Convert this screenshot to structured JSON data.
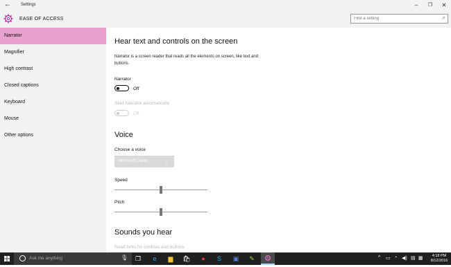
{
  "titlebar": {
    "back_glyph": "←",
    "app_title": "Settings",
    "min_glyph": "–",
    "max_glyph": "❐",
    "close_glyph": "✕"
  },
  "header": {
    "section_title": "EASE OF ACCESS",
    "search_placeholder": "Find a setting",
    "search_glyph": "⌕",
    "accent": "#b026a8"
  },
  "sidebar": {
    "items": [
      {
        "label": "Narrator",
        "active": true
      },
      {
        "label": "Magnifier"
      },
      {
        "label": "High contrast"
      },
      {
        "label": "Closed captions"
      },
      {
        "label": "Keyboard"
      },
      {
        "label": "Mouse"
      },
      {
        "label": "Other options"
      }
    ],
    "active_color": "#e9a2cf"
  },
  "main": {
    "heading": "Hear text and controls on the screen",
    "description": "Narrator is a screen reader that reads all the elements on screen, like text and buttons.",
    "narrator": {
      "label": "Narrator",
      "state": "Off"
    },
    "auto_start": {
      "label": "Start Narrator automatically",
      "state": "Off",
      "disabled": true
    },
    "voice_heading": "Voice",
    "choose_voice_label": "Choose a voice",
    "voice_value": "Microsoft David",
    "voice_chevron": "⌄",
    "speed": {
      "label": "Speed",
      "level": 0.5
    },
    "pitch": {
      "label": "Pitch",
      "level": 0.5
    },
    "sounds_heading": "Sounds you hear",
    "sounds_sub": "Read hints for controls and buttons"
  },
  "taskbar": {
    "search_placeholder": "Ask me anything",
    "mic_glyph": "🎙",
    "chevron_glyph": "^",
    "icons": [
      {
        "name": "task-view-icon",
        "glyph": "❐",
        "color": "#ffffff"
      },
      {
        "name": "edge-icon",
        "glyph": "e",
        "color": "#3a9bdc"
      },
      {
        "name": "file-explorer-icon",
        "glyph": "▆",
        "color": "#f3c13a"
      },
      {
        "name": "store-icon",
        "glyph": "🛍",
        "color": "#ffffff"
      },
      {
        "name": "chrome-icon",
        "glyph": "●",
        "color": "#e94235"
      },
      {
        "name": "skype-icon",
        "glyph": "S",
        "color": "#1ea5e6"
      },
      {
        "name": "app-icon",
        "glyph": "▣",
        "color": "#5b7fd6"
      },
      {
        "name": "paint-icon",
        "glyph": "✎",
        "color": "#9dd64a"
      }
    ],
    "clock_time": "4:18 PM",
    "clock_date": "8/12/2016"
  }
}
